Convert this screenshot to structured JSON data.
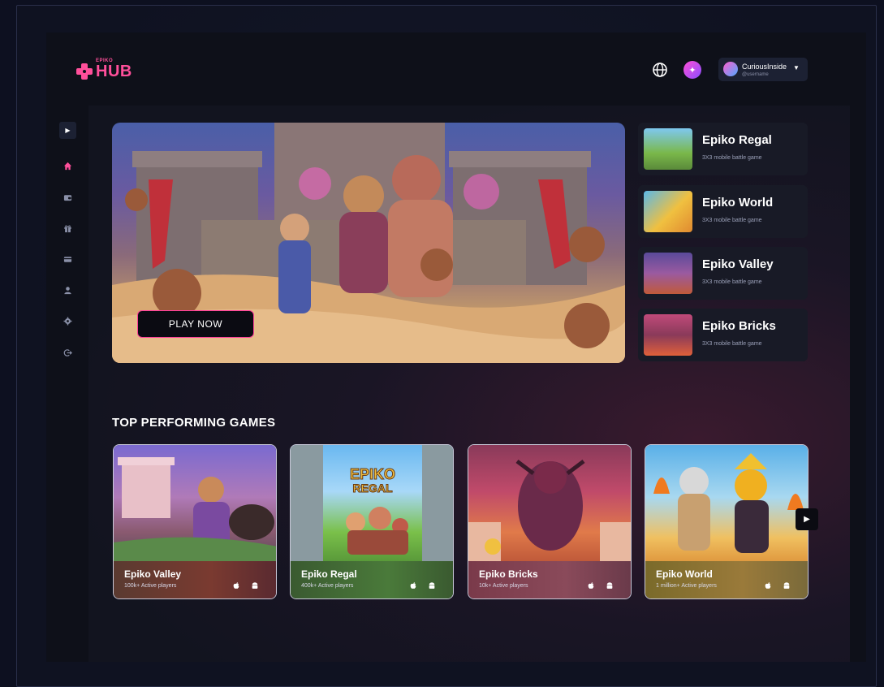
{
  "brand": {
    "small": "EPIKO",
    "big": "HUB",
    "color": "#ff4f9a"
  },
  "header": {
    "globe_icon": "globe-icon",
    "badge_icon": "sparkle-icon",
    "user": {
      "name": "CuriousInside",
      "handle": "@username"
    }
  },
  "sidebar": {
    "toggle_icon": "chevron-right-icon",
    "items": [
      {
        "name": "home",
        "icon": "home-icon",
        "active": true
      },
      {
        "name": "wallet",
        "icon": "wallet-icon"
      },
      {
        "name": "gifts",
        "icon": "gift-icon"
      },
      {
        "name": "cards",
        "icon": "card-icon"
      },
      {
        "name": "profile",
        "icon": "user-icon"
      },
      {
        "name": "settings",
        "icon": "gear-icon"
      },
      {
        "name": "logout",
        "icon": "logout-icon"
      }
    ]
  },
  "hero": {
    "cta": "PLAY NOW"
  },
  "side_games": [
    {
      "title": "Epiko Regal",
      "subtitle": "3X3 mobile battle game"
    },
    {
      "title": "Epiko World",
      "subtitle": "3X3 mobile battle game"
    },
    {
      "title": "Epiko Valley",
      "subtitle": "3X3 mobile battle game"
    },
    {
      "title": "Epiko Bricks",
      "subtitle": "3X3 mobile battle game"
    }
  ],
  "top_games": {
    "title": "TOP PERFORMING GAMES",
    "items": [
      {
        "title": "Epiko Valley",
        "players": "100k+ Active players"
      },
      {
        "title": "Epiko Regal",
        "players": "400k+ Active players"
      },
      {
        "title": "Epiko Bricks",
        "players": "10k+ Active players"
      },
      {
        "title": "Epiko World",
        "players": "1 million+ Active players"
      }
    ]
  }
}
